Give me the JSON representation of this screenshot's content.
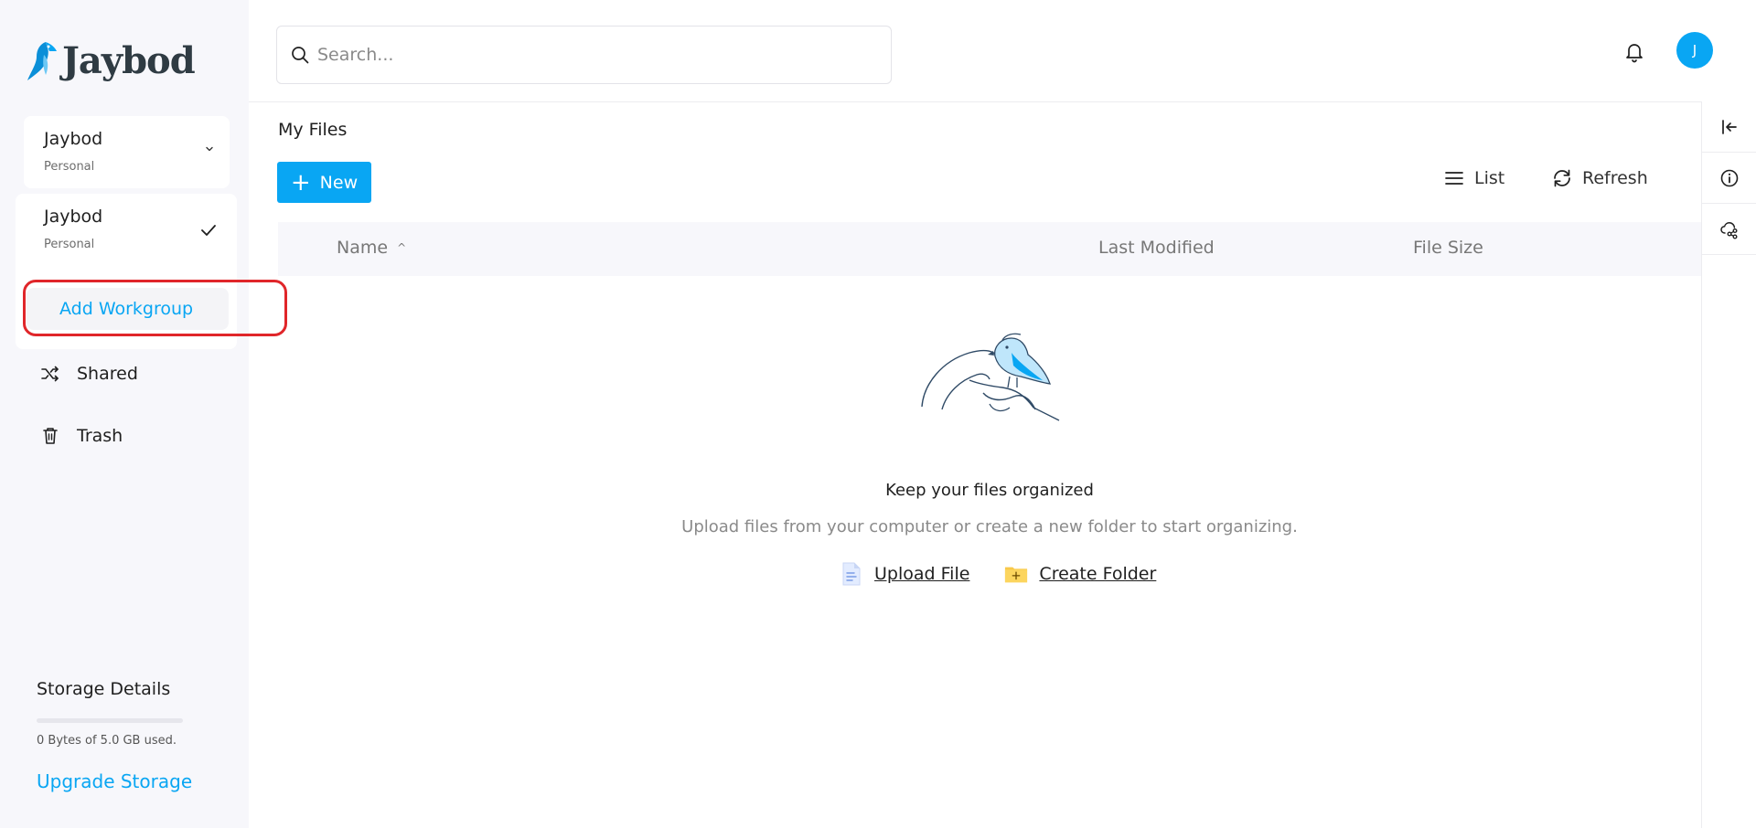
{
  "brand": {
    "name": "Jaybod"
  },
  "workspace": {
    "current": {
      "name": "Jaybod",
      "type": "Personal"
    },
    "options": [
      {
        "name": "Jaybod",
        "type": "Personal",
        "selected": true
      }
    ],
    "add_label": "Add Workgroup"
  },
  "nav": {
    "shared": "Shared",
    "trash": "Trash"
  },
  "storage": {
    "title": "Storage Details",
    "used_text": "0 Bytes of 5.0 GB used.",
    "used_fraction": 0,
    "upgrade_label": "Upgrade Storage"
  },
  "header": {
    "search_placeholder": "Search...",
    "avatar_initial": "J"
  },
  "main": {
    "title": "My Files",
    "new_label": "New",
    "list_label": "List",
    "refresh_label": "Refresh",
    "columns": {
      "name": "Name",
      "modified": "Last Modified",
      "size": "File Size"
    },
    "sort_indicator": "^",
    "empty": {
      "title": "Keep your files organized",
      "subtitle": "Upload files from your computer or create a new folder to start organizing.",
      "upload_label": "Upload File",
      "create_label": "Create Folder"
    }
  },
  "colors": {
    "accent": "#09a6f3",
    "highlight": "#e0262a",
    "sidebar_bg": "#f7f7fb"
  },
  "icons": {
    "search": "search-icon",
    "bell": "bell-icon",
    "chevron": "chevron-down-icon",
    "check": "check-icon",
    "shared": "shuffle-icon",
    "trash": "trash-icon",
    "collapse": "collapse-left-icon",
    "info": "info-icon",
    "share_cloud": "cloud-share-icon",
    "list": "list-icon",
    "refresh": "refresh-icon",
    "upload": "document-icon",
    "folder": "folder-plus-icon"
  }
}
